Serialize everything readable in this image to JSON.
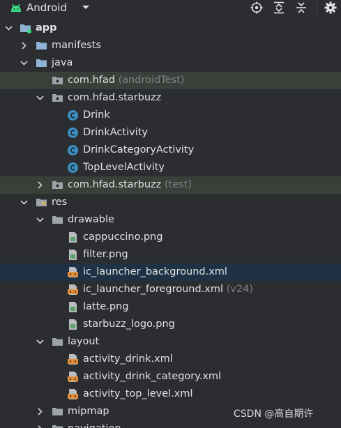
{
  "toolbar": {
    "title": "Android",
    "buttons": [
      "locate-icon",
      "expand-all-icon",
      "collapse-all-icon",
      "settings-icon"
    ]
  },
  "colors": {
    "background": "#2b2d30",
    "selected_row": "#1e3145",
    "test_row": "#393f39",
    "folder": "#8fb3d4",
    "class_circle": "#3c8fc2",
    "xml_orange": "#e58e3a",
    "png_green": "#5ea36a"
  },
  "tree": {
    "app": "app",
    "manifests": "manifests",
    "java": "java",
    "pkg_test": "com.hfad",
    "pkg_test_suffix": "(androidTest)",
    "pkg_main": "com.hfad.starbuzz",
    "classes": [
      "Drink",
      "DrinkActivity",
      "DrinkCategoryActivity",
      "TopLevelActivity"
    ],
    "pkg_unit": "com.hfad.starbuzz",
    "pkg_unit_suffix": "(test)",
    "res": "res",
    "drawable": "drawable",
    "drawable_files": [
      {
        "name": "cappuccino.png",
        "kind": "png"
      },
      {
        "name": "filter.png",
        "kind": "png"
      },
      {
        "name": "ic_launcher_background.xml",
        "kind": "xml"
      },
      {
        "name": "ic_launcher_foreground.xml",
        "kind": "xml",
        "suffix": "(v24)"
      },
      {
        "name": "latte.png",
        "kind": "png"
      },
      {
        "name": "starbuzz_logo.png",
        "kind": "png"
      }
    ],
    "layout": "layout",
    "layout_files": [
      "activity_drink.xml",
      "activity_drink_category.xml",
      "activity_top_level.xml"
    ],
    "mipmap": "mipmap",
    "navigation": "navigation"
  },
  "watermark": "CSDN @高自期许"
}
